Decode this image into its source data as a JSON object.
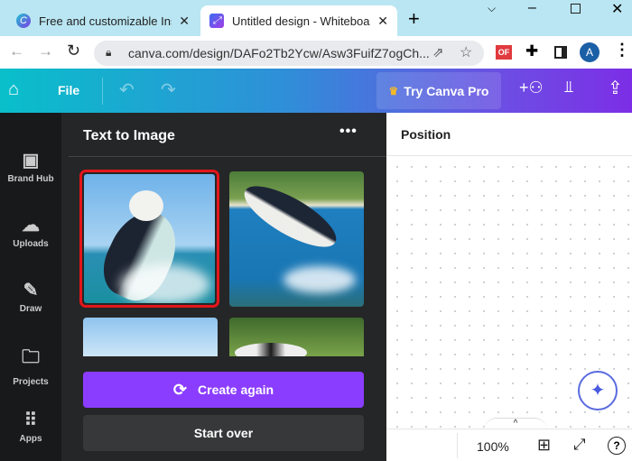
{
  "browser": {
    "tabs": [
      {
        "title": "Free and customizable Instag",
        "active": false
      },
      {
        "title": "Untitled design - Whiteboard",
        "active": true
      }
    ],
    "url": "canva.com/design/DAFo2Tb2Ycw/Asw3FuifZ7ogCh...",
    "profile_initial": "A",
    "extension_label": "OF"
  },
  "toolbar": {
    "file": "File",
    "try_pro": "Try Canva Pro"
  },
  "rail": [
    {
      "label": "Brand Hub",
      "icon": "brand-hub-icon"
    },
    {
      "label": "Uploads",
      "icon": "upload-cloud-icon"
    },
    {
      "label": "Draw",
      "icon": "draw-icon"
    },
    {
      "label": "Projects",
      "icon": "folder-icon"
    },
    {
      "label": "Apps",
      "icon": "apps-grid-icon"
    }
  ],
  "panel": {
    "title": "Text to Image",
    "create_again": "Create again",
    "start_over": "Start over",
    "selected_index": 0
  },
  "canvas": {
    "header": "Position",
    "zoom": "100%"
  },
  "colors": {
    "accent": "#8b3dff",
    "selection": "#e3161b",
    "panel": "#252627",
    "rail": "#18191b"
  }
}
